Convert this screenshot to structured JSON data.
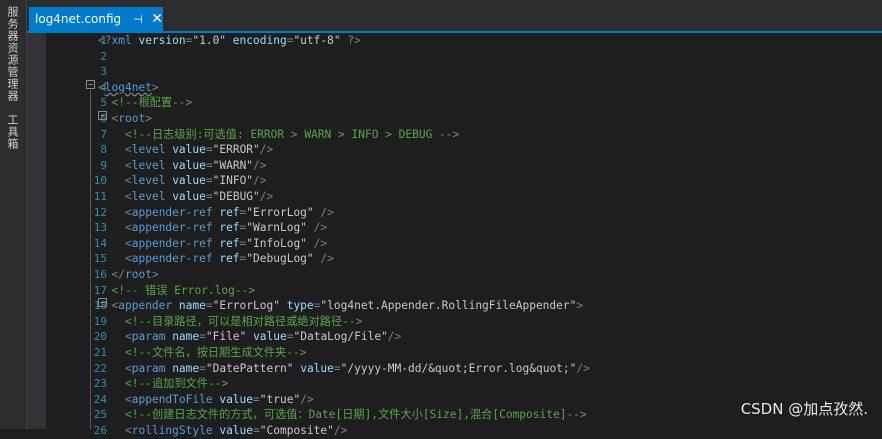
{
  "side_panel": {
    "tabs": [
      "服务器资源管理器",
      "工具箱"
    ]
  },
  "tab": {
    "filename": "log4net.config",
    "pin_glyph": "⊣",
    "close_glyph": "✕"
  },
  "colors": {
    "accent": "#007acc",
    "background": "#1e1e1e",
    "line_number": "#2b91af",
    "tag": "#569cd6",
    "attribute": "#9cdcfe",
    "comment": "#57a64a"
  },
  "editor": {
    "lines": [
      {
        "n": "1",
        "indent": 0,
        "tokens": [
          [
            "pun",
            "<?"
          ],
          [
            "tag",
            "xml"
          ],
          [
            "txt",
            " "
          ],
          [
            "attr",
            "version"
          ],
          [
            "pun",
            "="
          ],
          [
            "val",
            "\"1.0\""
          ],
          [
            "txt",
            " "
          ],
          [
            "attr",
            "encoding"
          ],
          [
            "pun",
            "="
          ],
          [
            "val",
            "\"utf-8\""
          ],
          [
            "txt",
            " "
          ],
          [
            "pun",
            "?>"
          ]
        ]
      },
      {
        "n": "2",
        "indent": 0,
        "tokens": []
      },
      {
        "n": "3",
        "indent": 0,
        "tokens": []
      },
      {
        "n": "4",
        "indent": 0,
        "tokens": [
          [
            "pun",
            "<"
          ],
          [
            "log",
            "log4net"
          ],
          [
            "pun",
            ">"
          ]
        ]
      },
      {
        "n": "5",
        "indent": 2,
        "tokens": [
          [
            "cmt",
            "<!--根配置-->"
          ]
        ]
      },
      {
        "n": "6",
        "indent": 2,
        "tokens": [
          [
            "pun",
            "<"
          ],
          [
            "tag",
            "root"
          ],
          [
            "pun",
            ">"
          ]
        ]
      },
      {
        "n": "7",
        "indent": 4,
        "tokens": [
          [
            "cmt",
            "<!--日志级别:可选值: ERROR > WARN > INFO > DEBUG -->"
          ]
        ]
      },
      {
        "n": "8",
        "indent": 4,
        "tokens": [
          [
            "pun",
            "<"
          ],
          [
            "tag",
            "level"
          ],
          [
            "txt",
            " "
          ],
          [
            "attr",
            "value"
          ],
          [
            "pun",
            "="
          ],
          [
            "val",
            "\"ERROR\""
          ],
          [
            "pun",
            "/>"
          ]
        ]
      },
      {
        "n": "9",
        "indent": 4,
        "tokens": [
          [
            "pun",
            "<"
          ],
          [
            "tag",
            "level"
          ],
          [
            "txt",
            " "
          ],
          [
            "attr",
            "value"
          ],
          [
            "pun",
            "="
          ],
          [
            "val",
            "\"WARN\""
          ],
          [
            "pun",
            "/>"
          ]
        ]
      },
      {
        "n": "10",
        "indent": 4,
        "tokens": [
          [
            "pun",
            "<"
          ],
          [
            "tag",
            "level"
          ],
          [
            "txt",
            " "
          ],
          [
            "attr",
            "value"
          ],
          [
            "pun",
            "="
          ],
          [
            "val",
            "\"INFO\""
          ],
          [
            "pun",
            "/>"
          ]
        ]
      },
      {
        "n": "11",
        "indent": 4,
        "tokens": [
          [
            "pun",
            "<"
          ],
          [
            "tag",
            "level"
          ],
          [
            "txt",
            " "
          ],
          [
            "attr",
            "value"
          ],
          [
            "pun",
            "="
          ],
          [
            "val",
            "\"DEBUG\""
          ],
          [
            "pun",
            "/>"
          ]
        ]
      },
      {
        "n": "12",
        "indent": 4,
        "tokens": [
          [
            "pun",
            "<"
          ],
          [
            "tag",
            "appender-ref"
          ],
          [
            "txt",
            " "
          ],
          [
            "attr",
            "ref"
          ],
          [
            "pun",
            "="
          ],
          [
            "val",
            "\"ErrorLog\""
          ],
          [
            "txt",
            " "
          ],
          [
            "pun",
            "/>"
          ]
        ]
      },
      {
        "n": "13",
        "indent": 4,
        "tokens": [
          [
            "pun",
            "<"
          ],
          [
            "tag",
            "appender-ref"
          ],
          [
            "txt",
            " "
          ],
          [
            "attr",
            "ref"
          ],
          [
            "pun",
            "="
          ],
          [
            "val",
            "\"WarnLog\""
          ],
          [
            "txt",
            " "
          ],
          [
            "pun",
            "/>"
          ]
        ]
      },
      {
        "n": "14",
        "indent": 4,
        "tokens": [
          [
            "pun",
            "<"
          ],
          [
            "tag",
            "appender-ref"
          ],
          [
            "txt",
            " "
          ],
          [
            "attr",
            "ref"
          ],
          [
            "pun",
            "="
          ],
          [
            "val",
            "\"InfoLog\""
          ],
          [
            "txt",
            " "
          ],
          [
            "pun",
            "/>"
          ]
        ]
      },
      {
        "n": "15",
        "indent": 4,
        "tokens": [
          [
            "pun",
            "<"
          ],
          [
            "tag",
            "appender-ref"
          ],
          [
            "txt",
            " "
          ],
          [
            "attr",
            "ref"
          ],
          [
            "pun",
            "="
          ],
          [
            "val",
            "\"DebugLog\""
          ],
          [
            "txt",
            " "
          ],
          [
            "pun",
            "/>"
          ]
        ]
      },
      {
        "n": "16",
        "indent": 2,
        "tokens": [
          [
            "pun",
            "</"
          ],
          [
            "tag",
            "root"
          ],
          [
            "pun",
            ">"
          ]
        ]
      },
      {
        "n": "17",
        "indent": 2,
        "tokens": [
          [
            "cmt",
            "<!-- 错误 Error.log-->"
          ]
        ]
      },
      {
        "n": "18",
        "indent": 2,
        "tokens": [
          [
            "pun",
            "<"
          ],
          [
            "tag",
            "appender"
          ],
          [
            "txt",
            " "
          ],
          [
            "attr",
            "name"
          ],
          [
            "pun",
            "="
          ],
          [
            "val",
            "\"ErrorLog\""
          ],
          [
            "txt",
            " "
          ],
          [
            "attr",
            "type"
          ],
          [
            "pun",
            "="
          ],
          [
            "val",
            "\"log4net.Appender.RollingFileAppender\""
          ],
          [
            "pun",
            ">"
          ]
        ]
      },
      {
        "n": "19",
        "indent": 4,
        "tokens": [
          [
            "cmt",
            "<!--目录路径，可以是相对路径或绝对路径-->"
          ]
        ]
      },
      {
        "n": "20",
        "indent": 4,
        "tokens": [
          [
            "pun",
            "<"
          ],
          [
            "tag",
            "param"
          ],
          [
            "txt",
            " "
          ],
          [
            "attr",
            "name"
          ],
          [
            "pun",
            "="
          ],
          [
            "val",
            "\"File\""
          ],
          [
            "txt",
            " "
          ],
          [
            "attr",
            "value"
          ],
          [
            "pun",
            "="
          ],
          [
            "val",
            "\"DataLog/File\""
          ],
          [
            "pun",
            "/>"
          ]
        ]
      },
      {
        "n": "21",
        "indent": 4,
        "tokens": [
          [
            "cmt",
            "<!--文件名，按日期生成文件夹-->"
          ]
        ]
      },
      {
        "n": "22",
        "indent": 4,
        "tokens": [
          [
            "pun",
            "<"
          ],
          [
            "tag",
            "param"
          ],
          [
            "txt",
            " "
          ],
          [
            "attr",
            "name"
          ],
          [
            "pun",
            "="
          ],
          [
            "val",
            "\"DatePattern\""
          ],
          [
            "txt",
            " "
          ],
          [
            "attr",
            "value"
          ],
          [
            "pun",
            "="
          ],
          [
            "val",
            "\"/yyyy-MM-dd/&quot;Error.log&quot;\""
          ],
          [
            "pun",
            "/>"
          ]
        ]
      },
      {
        "n": "23",
        "indent": 4,
        "tokens": [
          [
            "cmt",
            "<!--追加到文件-->"
          ]
        ]
      },
      {
        "n": "24",
        "indent": 4,
        "tokens": [
          [
            "pun",
            "<"
          ],
          [
            "tag",
            "appendToFile"
          ],
          [
            "txt",
            " "
          ],
          [
            "attr",
            "value"
          ],
          [
            "pun",
            "="
          ],
          [
            "val",
            "\"true\""
          ],
          [
            "pun",
            "/>"
          ]
        ]
      },
      {
        "n": "25",
        "indent": 4,
        "tokens": [
          [
            "cmt",
            "<!--创建日志文件的方式，可选值：Date[日期],文件大小[Size],混合[Composite]-->"
          ]
        ]
      },
      {
        "n": "26",
        "indent": 4,
        "tokens": [
          [
            "pun",
            "<"
          ],
          [
            "tag",
            "rollingStyle"
          ],
          [
            "txt",
            " "
          ],
          [
            "attr",
            "value"
          ],
          [
            "pun",
            "="
          ],
          [
            "val",
            "\"Composite\""
          ],
          [
            "pun",
            "/>"
          ]
        ]
      }
    ]
  },
  "watermark": "CSDN @加点孜然."
}
